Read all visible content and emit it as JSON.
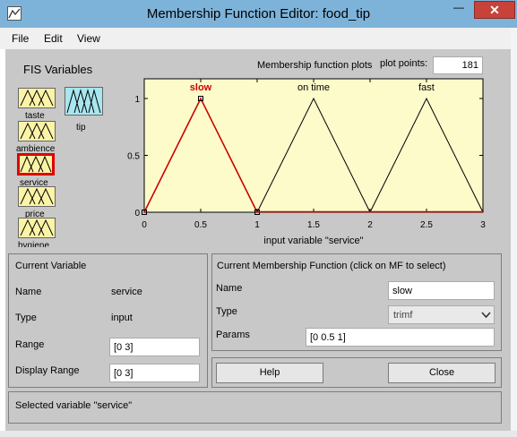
{
  "window": {
    "title": "Membership Function Editor: food_tip",
    "close_glyph": "✕",
    "minimize_glyph": "—"
  },
  "menu": [
    "File",
    "Edit",
    "View"
  ],
  "fis": {
    "title": "FIS Variables",
    "inputs": [
      "taste",
      "ambience",
      "service",
      "price",
      "hygiene"
    ],
    "output": "tip",
    "selected": "service"
  },
  "plot": {
    "title": "Membership function plots",
    "plot_points_label": "plot points:",
    "plot_points_value": "181",
    "xlabel": "input variable \"service\"",
    "mf_labels": [
      "slow",
      "on time",
      "fast"
    ]
  },
  "chart_data": {
    "type": "line",
    "xlim": [
      0,
      3
    ],
    "ylim": [
      0,
      1
    ],
    "xticks": [
      "0",
      "0.5",
      "1",
      "1.5",
      "2",
      "2.5",
      "3"
    ],
    "yticks": [
      "0",
      "0.5",
      "1"
    ],
    "series": [
      {
        "name": "slow",
        "x": [
          0,
          0.5,
          1
        ],
        "y": [
          0,
          1,
          0
        ],
        "color": "#cc0000",
        "selected": true
      },
      {
        "name": "on time",
        "x": [
          1,
          1.5,
          2
        ],
        "y": [
          0,
          1,
          0
        ],
        "color": "#000000"
      },
      {
        "name": "fast",
        "x": [
          2,
          2.5,
          3
        ],
        "y": [
          0,
          1,
          0
        ],
        "color": "#000000"
      }
    ]
  },
  "current_variable": {
    "title": "Current Variable",
    "name_label": "Name",
    "name_value": "service",
    "type_label": "Type",
    "type_value": "input",
    "range_label": "Range",
    "range_value": "[0 3]",
    "display_range_label": "Display Range",
    "display_range_value": "[0 3]"
  },
  "current_mf": {
    "title": "Current Membership Function (click on MF to select)",
    "name_label": "Name",
    "name_value": "slow",
    "type_label": "Type",
    "type_value": "trimf",
    "params_label": "Params",
    "params_value": "[0 0.5 1]"
  },
  "buttons": {
    "help": "Help",
    "close": "Close"
  },
  "status": "Selected variable \"service\"",
  "colors": {
    "input_var": "#fbf4a6",
    "output_var": "#a8e6f0",
    "plot_bg": "#fdfbca",
    "selected": "#e00000"
  }
}
